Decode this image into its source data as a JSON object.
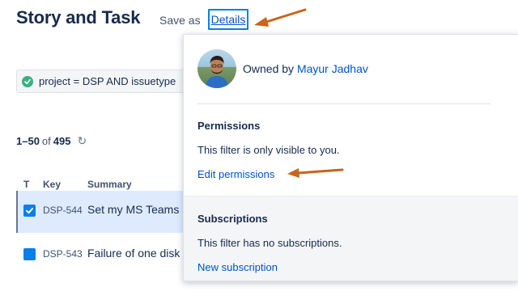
{
  "header": {
    "title": "Story and Task",
    "save_as_label": "Save as",
    "details_label": "Details"
  },
  "query": {
    "text": "project = DSP AND issuetype"
  },
  "results": {
    "range": "1–50",
    "of_label": "of",
    "total": "495"
  },
  "table": {
    "columns": [
      "T",
      "Key",
      "Summary"
    ],
    "rows": [
      {
        "key": "DSP-544",
        "summary": "Set my MS Teams a"
      },
      {
        "key": "DSP-543",
        "summary": "Failure of one disk f"
      }
    ]
  },
  "details_popup": {
    "owned_by_label": "Owned by",
    "owner_name": "Mayur Jadhav",
    "permissions": {
      "title": "Permissions",
      "text": "This filter is only visible to you.",
      "link": "Edit permissions"
    },
    "subscriptions": {
      "title": "Subscriptions",
      "text": "This filter has no subscriptions.",
      "link": "New subscription"
    }
  },
  "colors": {
    "link": "#0052cc",
    "highlight_box": "#0b7ee8",
    "annotation_arrow": "#c8651b",
    "success": "#36b37e",
    "selected_row": "#deebff"
  }
}
